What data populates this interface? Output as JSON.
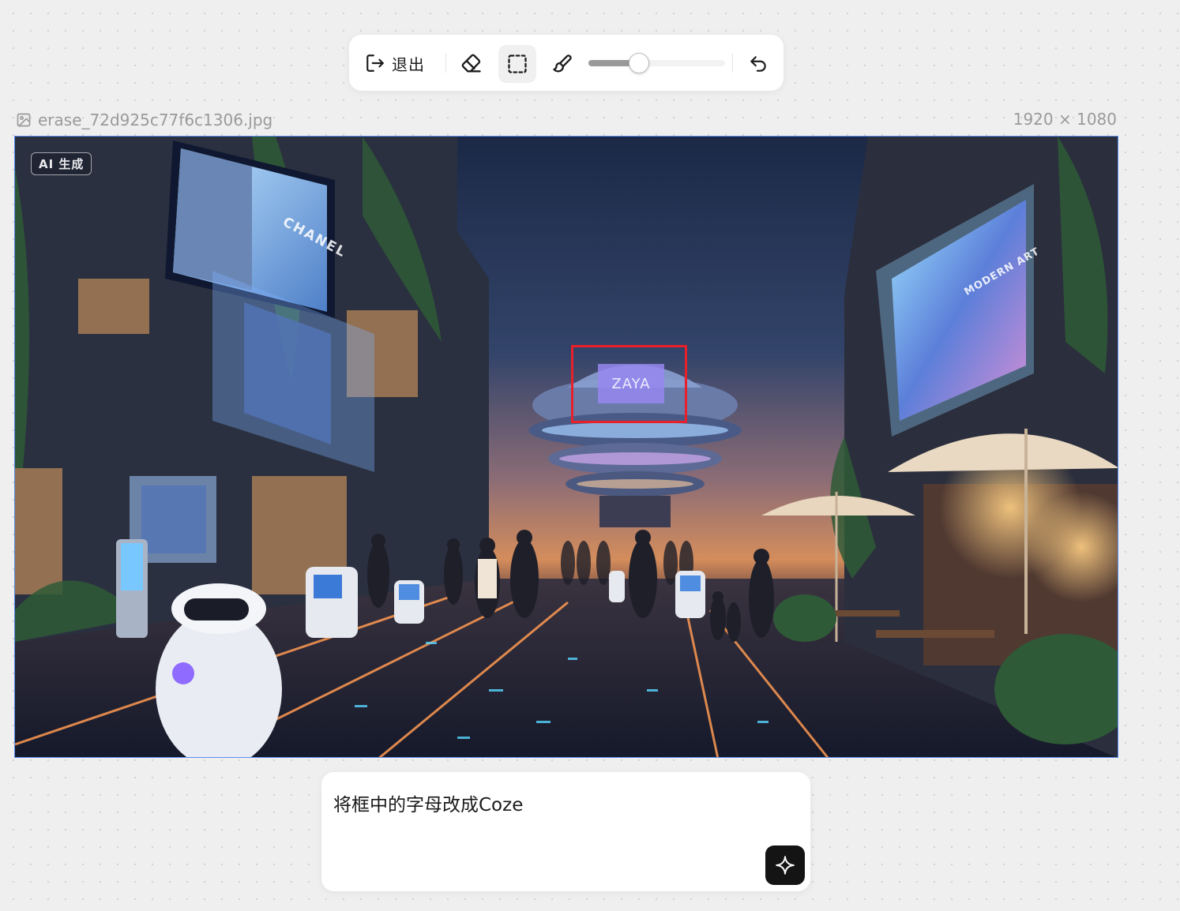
{
  "toolbar": {
    "exit_label": "退出",
    "brush_size_percent": 37,
    "icons": {
      "exit": "logout-icon",
      "eraser": "eraser-icon",
      "select": "rect-select-icon",
      "brush": "brush-icon",
      "undo": "undo-icon"
    },
    "active_tool": "select"
  },
  "file": {
    "name": "erase_72d925c77f6c1306.jpg",
    "dimensions": "1920 × 1080",
    "icon": "image-icon"
  },
  "canvas": {
    "ai_badge": "AI 生成",
    "center_sign": "ZAYA",
    "left_billboard": "CHANEL",
    "right_billboard": "MODERN ART",
    "selection_color": "#e8202a",
    "border_color": "#5b8def"
  },
  "prompt": {
    "text": "将框中的字母改成Coze",
    "send_icon": "sparkle-icon"
  }
}
